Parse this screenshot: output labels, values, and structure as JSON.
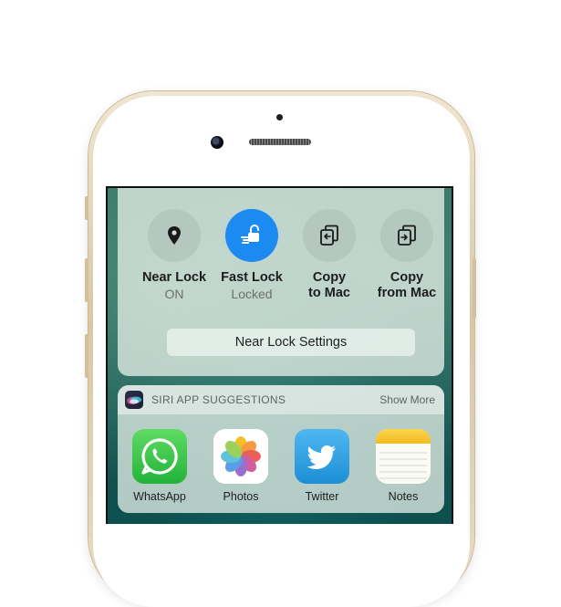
{
  "actions": [
    {
      "label": "Near Lock",
      "sub": "ON",
      "icon": "location-pin-icon",
      "active": false
    },
    {
      "label": "Fast Lock",
      "sub": "Locked",
      "icon": "unlock-hand-icon",
      "active": true
    },
    {
      "label": "Copy\nto Mac",
      "sub": "",
      "icon": "copy-to-mac-icon",
      "active": false
    },
    {
      "label": "Copy\nfrom Mac",
      "sub": "",
      "icon": "copy-from-mac-icon",
      "active": false
    }
  ],
  "settings_button": "Near Lock Settings",
  "siri": {
    "title": "SIRI APP SUGGESTIONS",
    "show_more": "Show More",
    "apps": [
      "WhatsApp",
      "Photos",
      "Twitter",
      "Notes"
    ]
  },
  "colors": {
    "accent": "#1b8bf1",
    "whatsapp": "#2bbd3a",
    "twitter": "#1da1f2",
    "notes": "#f7c531"
  }
}
